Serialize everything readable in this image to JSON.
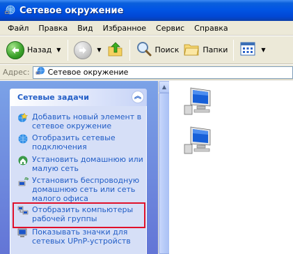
{
  "window": {
    "title": "Сетевое окружение"
  },
  "menu": [
    "Файл",
    "Правка",
    "Вид",
    "Избранное",
    "Сервис",
    "Справка"
  ],
  "toolbar": {
    "back_label": "Назад",
    "search_label": "Поиск",
    "folders_label": "Папки"
  },
  "address": {
    "label": "Адрес:",
    "value": "Сетевое окружение"
  },
  "taskpane": {
    "header": "Сетевые задачи",
    "tasks": [
      {
        "label": "Добавить новый элемент в сетевое окружение",
        "icon": "add-network-place-icon"
      },
      {
        "label": "Отобразить сетевые подключения",
        "icon": "network-connections-icon"
      },
      {
        "label": "Установить домашнюю или малую сеть",
        "icon": "home-network-setup-icon"
      },
      {
        "label": "Установить беспроводную домашнюю сеть или сеть малого офиса",
        "icon": "wireless-network-setup-icon"
      },
      {
        "label": "Отобразить компьютеры рабочей группы",
        "icon": "workgroup-computers-icon"
      },
      {
        "label": "Показывать значки для сетевых UPnP-устройств",
        "icon": "upnp-devices-icon"
      }
    ]
  },
  "content": {
    "items": [
      {
        "icon": "network-computer-icon"
      },
      {
        "icon": "network-computer-icon"
      }
    ]
  },
  "colors": {
    "titlebar": "#0155e4",
    "task_link": "#215dc6",
    "taskpane_bg": "#6375d6",
    "highlight": "#e0102a"
  }
}
